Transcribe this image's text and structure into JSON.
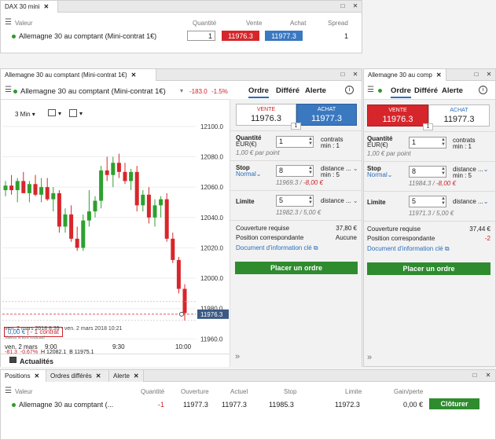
{
  "top": {
    "tab": "DAX 30 mini",
    "headers": {
      "valeur": "Valeur",
      "quantite": "Quantité",
      "vente": "Vente",
      "achat": "Achat",
      "spread": "Spread"
    },
    "row": {
      "name": "Allemagne 30 au comptant (Mini-contrat 1€)",
      "qty": "1",
      "vente": "11976.3",
      "achat": "11977.3",
      "spread": "1"
    }
  },
  "main": {
    "tab": "Allemagne 30 au comptant (Mini-contrat 1€)",
    "title": "Allemagne 30 au comptant (Mini-contrat 1€)",
    "change": "-183.0",
    "change_pct": "-1.5%",
    "order_tabs": [
      "Ordre",
      "Différé",
      "Alerte"
    ],
    "interval": "3 Min",
    "chart_tag": "11976.3",
    "position_value": "0,00 €",
    "position_label": "- 1 contrat",
    "stats": {
      "chg": "-81.3",
      "chg_pct": "-0.67%",
      "high": "H 12082.1",
      "low": "B 11975.1"
    },
    "date_range": "ven. 2 mars 2018 8:39 - ven. 2 mars 2018 10:21",
    "indicatif": "Valeur à titre indicatif",
    "footer": "Actualités",
    "order": {
      "vente_label": "VENTE",
      "vente_price": "11976.3",
      "achat_label": "ACHAT",
      "achat_price": "11977.3",
      "spread": "1",
      "qty_label": "Quantité",
      "qty_unit": "EUR(€)",
      "qty_value": "1",
      "qty_right1": "contrats",
      "qty_right2": "min : 1",
      "qty_note": "1,00 € par point",
      "stop_label": "Stop",
      "stop_type": "Normal",
      "stop_value": "8",
      "stop_right1": "distance ...",
      "stop_right2": "min : 5",
      "stop_note_level": "11969.3 /",
      "stop_note_amount": "-8,00 €",
      "limit_label": "Limite",
      "limit_value": "5",
      "limit_right1": "distance ...",
      "limit_note": "11982.3 / 5,00 €",
      "couverture_label": "Couverture requise",
      "couverture_value": "37,80 €",
      "position_label": "Position correspondante",
      "position_value": "Aucune",
      "doc_link": "Document d'information clé",
      "place_btn": "Placer un ordre"
    }
  },
  "side": {
    "tab": "Allemagne 30 au comp",
    "order_tabs": [
      "Ordre",
      "Différé",
      "Alerte"
    ],
    "vente_label": "VENTE",
    "vente_price": "11976.3",
    "achat_label": "ACHAT",
    "achat_price": "11977.3",
    "spread": "1",
    "qty_label": "Quantité",
    "qty_unit": "EUR(€)",
    "qty_value": "1",
    "qty_right1": "contrats",
    "qty_right2": "min : 1",
    "qty_note": "1,00 € par point",
    "stop_label": "Stop",
    "stop_type": "Normal",
    "stop_value": "8",
    "stop_right1": "distance ...",
    "stop_right2": "min : 5",
    "stop_note_level": "11984.3 /",
    "stop_note_amount": "-8,00 €",
    "limit_label": "Limite",
    "limit_value": "5",
    "limit_right1": "distance ...",
    "limit_note": "11971.3 / 5,00 €",
    "couverture_label": "Couverture requise",
    "couverture_value": "37,44 €",
    "position_label": "Position correspondante",
    "position_value": "-2",
    "doc_link": "Document d'information clé",
    "place_btn": "Placer un ordre"
  },
  "bottom": {
    "tabs": [
      "Positions",
      "Ordres différés",
      "Alerte"
    ],
    "headers": {
      "valeur": "Valeur",
      "quantite": "Quantité",
      "ouverture": "Ouverture",
      "actuel": "Actuel",
      "stop": "Stop",
      "limite": "Limite",
      "gain": "Gain/perte"
    },
    "row": {
      "name": "Allemagne 30 au comptant (...",
      "qty": "-1",
      "ouverture": "11977.3",
      "actuel": "11977.3",
      "stop": "11985.3",
      "limite": "11972.3",
      "gain": "0,00 €",
      "close_btn": "Clôturer"
    }
  },
  "colors": {
    "sell": "#d6262b",
    "buy": "#3a78c0",
    "up": "#2ea02e",
    "down": "#d8262b",
    "action": "#2e8b2e"
  },
  "chart_data": {
    "type": "candlestick",
    "y_ticks": [
      "12100.0",
      "12080.0",
      "12060.0",
      "12040.0",
      "12020.0",
      "12000.0",
      "11980.0",
      "11960.0"
    ],
    "x_ticks": [
      "ven. 2 mars",
      "9:00",
      "9:30",
      "10:00"
    ],
    "ylim": [
      11955,
      12102
    ],
    "candles": [
      {
        "o": 12058,
        "h": 12064,
        "l": 12054,
        "c": 12061
      },
      {
        "o": 12061,
        "h": 12068,
        "l": 12055,
        "c": 12058
      },
      {
        "o": 12058,
        "h": 12066,
        "l": 12050,
        "c": 12064
      },
      {
        "o": 12064,
        "h": 12070,
        "l": 12058,
        "c": 12056
      },
      {
        "o": 12056,
        "h": 12064,
        "l": 12050,
        "c": 12062
      },
      {
        "o": 12062,
        "h": 12068,
        "l": 12054,
        "c": 12055
      },
      {
        "o": 12055,
        "h": 12066,
        "l": 12050,
        "c": 12060
      },
      {
        "o": 12060,
        "h": 12066,
        "l": 12051,
        "c": 12052
      },
      {
        "o": 12052,
        "h": 12060,
        "l": 12044,
        "c": 12056
      },
      {
        "o": 12056,
        "h": 12058,
        "l": 12030,
        "c": 12034
      },
      {
        "o": 12034,
        "h": 12046,
        "l": 12030,
        "c": 12042
      },
      {
        "o": 12042,
        "h": 12048,
        "l": 12024,
        "c": 12026
      },
      {
        "o": 12026,
        "h": 12034,
        "l": 12018,
        "c": 12020
      },
      {
        "o": 12020,
        "h": 12042,
        "l": 12018,
        "c": 12038
      },
      {
        "o": 12038,
        "h": 12058,
        "l": 12034,
        "c": 12044
      },
      {
        "o": 12044,
        "h": 12054,
        "l": 12040,
        "c": 12051
      },
      {
        "o": 12051,
        "h": 12074,
        "l": 12046,
        "c": 12071
      },
      {
        "o": 12071,
        "h": 12080,
        "l": 12064,
        "c": 12068
      },
      {
        "o": 12068,
        "h": 12080,
        "l": 12060,
        "c": 12076
      },
      {
        "o": 12076,
        "h": 12082,
        "l": 12066,
        "c": 12070
      },
      {
        "o": 12070,
        "h": 12076,
        "l": 12062,
        "c": 12064
      },
      {
        "o": 12064,
        "h": 12072,
        "l": 12058,
        "c": 12070
      },
      {
        "o": 12070,
        "h": 12074,
        "l": 12044,
        "c": 12048
      },
      {
        "o": 12048,
        "h": 12058,
        "l": 12044,
        "c": 12055
      },
      {
        "o": 12055,
        "h": 12060,
        "l": 12036,
        "c": 12040
      },
      {
        "o": 12040,
        "h": 12052,
        "l": 12034,
        "c": 12048
      },
      {
        "o": 12048,
        "h": 12054,
        "l": 12040,
        "c": 12052
      },
      {
        "o": 12052,
        "h": 12056,
        "l": 12024,
        "c": 12026
      },
      {
        "o": 12026,
        "h": 12030,
        "l": 12010,
        "c": 12012
      },
      {
        "o": 12012,
        "h": 12014,
        "l": 11990,
        "c": 11993
      },
      {
        "o": 11993,
        "h": 11996,
        "l": 11972,
        "c": 11977
      }
    ],
    "current": 11976.3
  }
}
